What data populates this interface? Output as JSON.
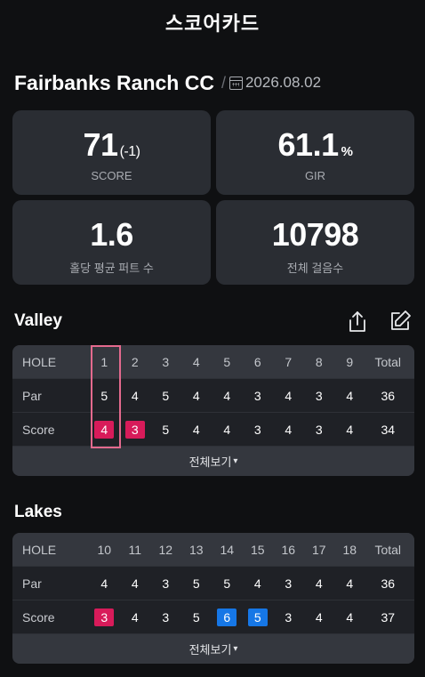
{
  "header": {
    "title": "스코어카드"
  },
  "course": {
    "name": "Fairbanks Ranch CC",
    "separator": "/",
    "date": "2026.08.02"
  },
  "stats": [
    {
      "value": "71",
      "suffix": "(-1)",
      "label": "SCORE"
    },
    {
      "value": "61.1",
      "suffix": "%",
      "label": "GIR"
    },
    {
      "value": "1.6",
      "suffix": "",
      "label": "홀당 평균 퍼트 수"
    },
    {
      "value": "10798",
      "suffix": "",
      "label": "전체 걸음수"
    }
  ],
  "valley": {
    "title": "Valley",
    "header": [
      "HOLE",
      "1",
      "2",
      "3",
      "4",
      "5",
      "6",
      "7",
      "8",
      "9",
      "Total"
    ],
    "par": [
      "Par",
      "5",
      "4",
      "5",
      "4",
      "4",
      "3",
      "4",
      "3",
      "4",
      "36"
    ],
    "score": [
      "Score",
      "4",
      "3",
      "5",
      "4",
      "4",
      "3",
      "4",
      "3",
      "4",
      "34"
    ],
    "score_marks": [
      "",
      "red",
      "red",
      "",
      "",
      "",
      "",
      "",
      "",
      "",
      ""
    ],
    "more_label": "전체보기"
  },
  "lakes": {
    "title": "Lakes",
    "header": [
      "HOLE",
      "10",
      "11",
      "12",
      "13",
      "14",
      "15",
      "16",
      "17",
      "18",
      "Total"
    ],
    "par": [
      "Par",
      "4",
      "4",
      "3",
      "5",
      "5",
      "4",
      "3",
      "4",
      "4",
      "36"
    ],
    "score": [
      "Score",
      "3",
      "4",
      "3",
      "5",
      "6",
      "5",
      "3",
      "4",
      "4",
      "37"
    ],
    "score_marks": [
      "",
      "red",
      "",
      "",
      "",
      "blue",
      "blue",
      "",
      "",
      "",
      ""
    ],
    "more_label": "전체보기"
  },
  "icons": {
    "share": "share-icon",
    "edit": "edit-icon",
    "calendar": "calendar-icon",
    "chevron": "chevron-down-icon"
  },
  "colors": {
    "birdie": "#d81b5a",
    "bogey": "#1677e6",
    "highlight": "#e46a8e"
  }
}
